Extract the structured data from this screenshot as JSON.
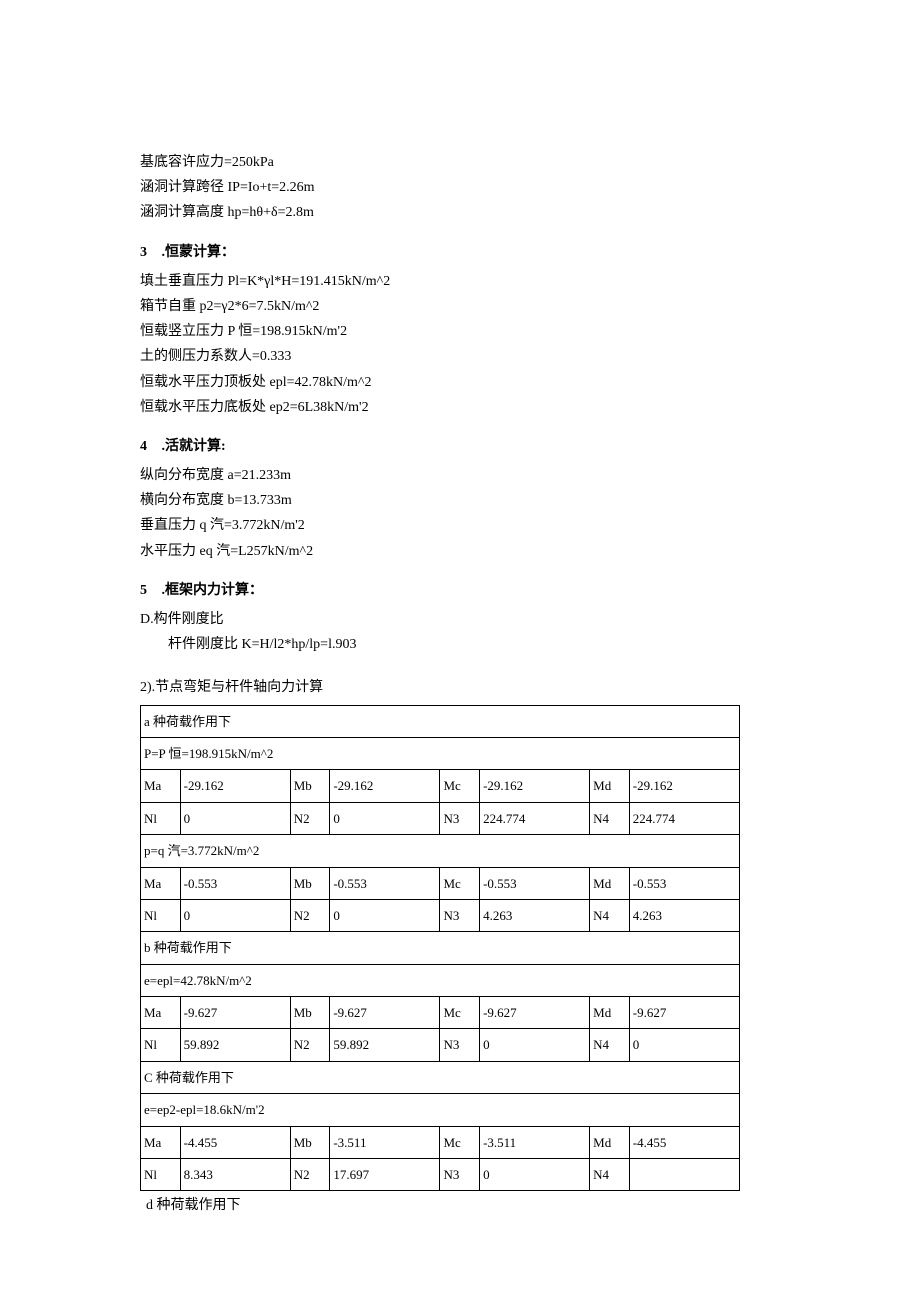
{
  "pre_lines": [
    "基底容许应力=250kPa",
    "涵洞计算跨径 IP=Io+t=2.26m",
    "涵洞计算高度 hp=hθ+δ=2.8m"
  ],
  "sec3": {
    "num": "3",
    "title": ".恒蒙计算：",
    "lines": [
      "填土垂直压力 Pl=K*γl*H=191.415kN/m^2",
      "箱节自重 p2=γ2*6=7.5kN/m^2",
      "恒载竖立压力 P 恒=198.915kN/m'2",
      "土的侧压力系数人=0.333",
      "恒载水平压力顶板处 epl=42.78kN/m^2",
      "恒载水平压力底板处 ep2=6L38kN/m'2"
    ]
  },
  "sec4": {
    "num": "4",
    "title": ".活就计算:",
    "lines": [
      "纵向分布宽度 a=21.233m",
      "横向分布宽度 b=13.733m",
      "垂直压力 q 汽=3.772kN/m'2",
      "水平压力 eq 汽=L257kN/m^2"
    ]
  },
  "sec5": {
    "num": "5",
    "title": ".框架内力计算：",
    "lineD": "D.构件刚度比",
    "lineK": "杆件刚度比 K=H/l2*hp/lp=l.903",
    "line2": "2).节点弯矩与杆件轴向力计算"
  },
  "table": {
    "a_title": "a 种荷载作用下",
    "a_p": "P=P 恒=198.915kN/m^2",
    "a_ma": [
      "Ma",
      "-29.162",
      "Mb",
      "-29.162",
      "Mc",
      "-29.162",
      "Md",
      "-29.162"
    ],
    "a_nl": [
      "Nl",
      "0",
      "N2",
      "0",
      "N3",
      "224.774",
      "N4",
      "224.774"
    ],
    "a_pq": "p=q 汽=3.772kN/m^2",
    "a_ma2": [
      "Ma",
      "-0.553",
      "Mb",
      "-0.553",
      "Mc",
      "-0.553",
      "Md",
      "-0.553"
    ],
    "a_nl2": [
      "Nl",
      "0",
      "N2",
      "0",
      "N3",
      "4.263",
      "N4",
      "4.263"
    ],
    "b_title": "b 种荷载作用下",
    "b_e": "e=epl=42.78kN/m^2",
    "b_ma": [
      "Ma",
      "-9.627",
      "Mb",
      "-9.627",
      "Mc",
      "-9.627",
      "Md",
      "-9.627"
    ],
    "b_nl": [
      "Nl",
      "59.892",
      "N2",
      "59.892",
      "N3",
      "0",
      "N4",
      "0"
    ],
    "c_title": "C 种荷载作用下",
    "c_e": "e=ep2-epl=18.6kN/m'2",
    "c_ma": [
      "Ma",
      "-4.455",
      "Mb",
      "-3.511",
      "Mc",
      "-3.511",
      "Md",
      "-4.455"
    ],
    "c_nl": [
      "Nl",
      "8.343",
      "N2",
      "17.697",
      "N3",
      "0",
      "N4",
      ""
    ]
  },
  "footer_line": "d 种荷载作用下"
}
